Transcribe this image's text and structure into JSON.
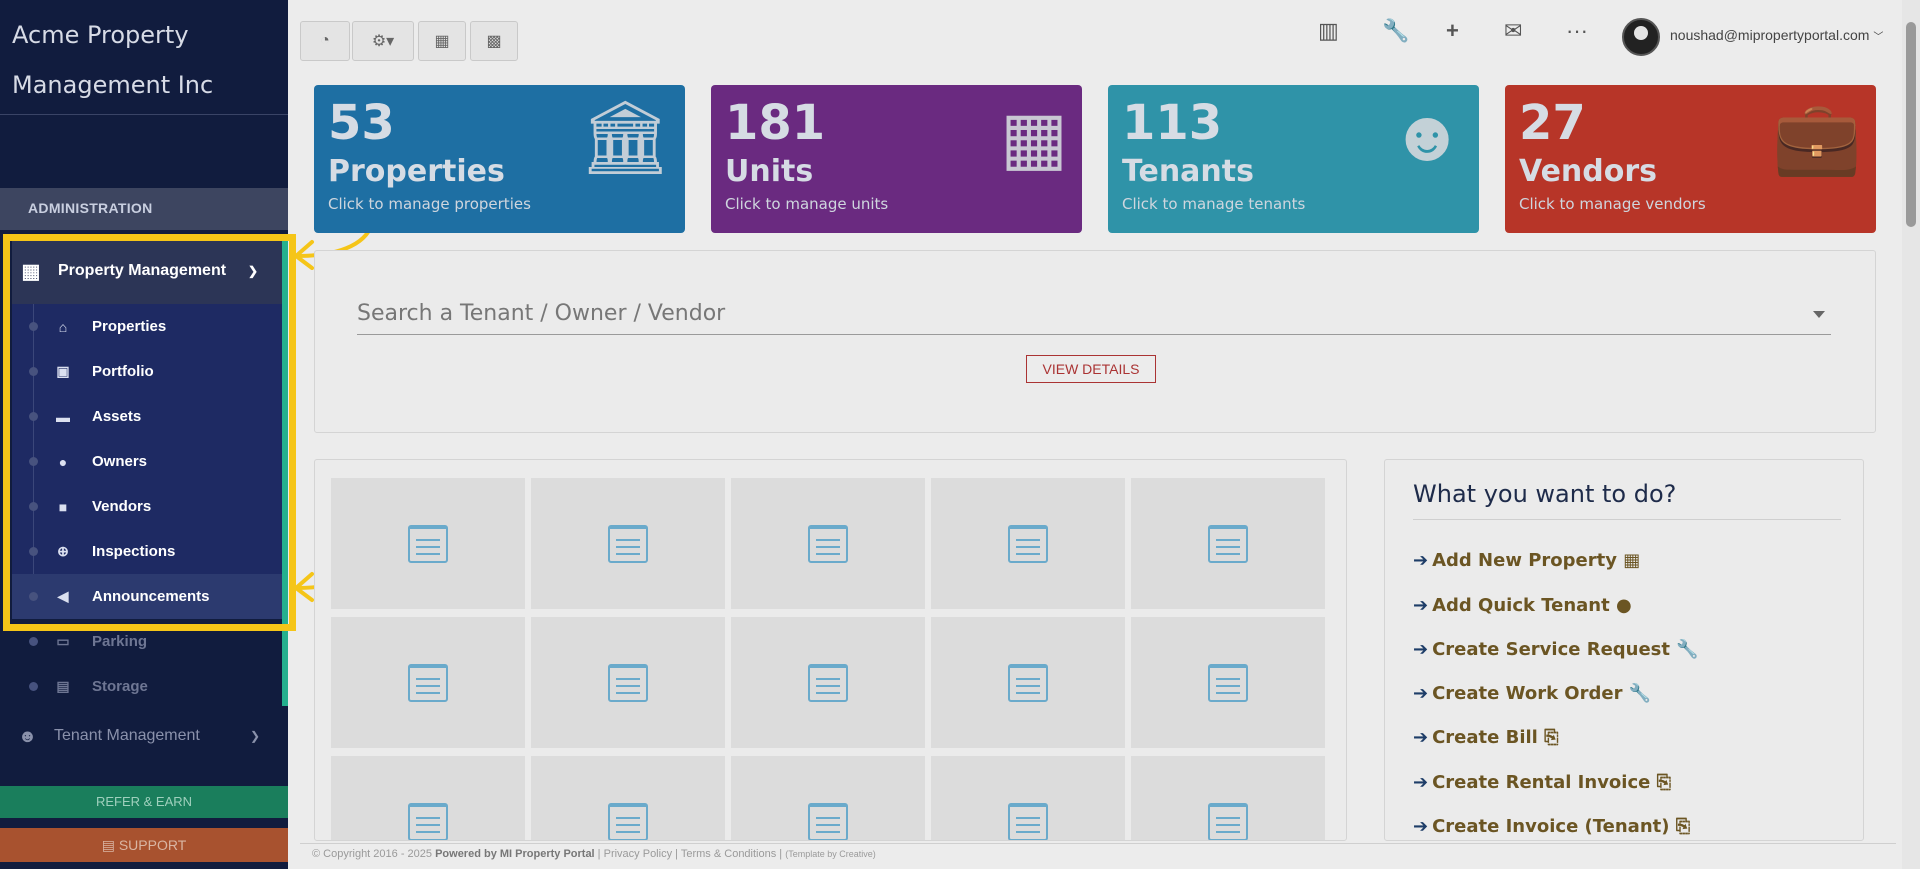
{
  "sidebar": {
    "brand": "Acme Property Management Inc",
    "section_header": "ADMINISTRATION",
    "property_management": {
      "label": "Property Management",
      "items": [
        {
          "label": "Properties",
          "icon": "home-icon"
        },
        {
          "label": "Portfolio",
          "icon": "portfolio-icon"
        },
        {
          "label": "Assets",
          "icon": "archive-icon"
        },
        {
          "label": "Owners",
          "icon": "user-icon"
        },
        {
          "label": "Vendors",
          "icon": "briefcase-icon"
        },
        {
          "label": "Inspections",
          "icon": "search-plus-icon"
        },
        {
          "label": "Announcements",
          "icon": "bullhorn-icon"
        },
        {
          "label": "Parking",
          "icon": "car-icon"
        },
        {
          "label": "Storage",
          "icon": "basket-icon"
        }
      ]
    },
    "tenant_management": "Tenant Management",
    "refer": "REFER & EARN",
    "support": "SUPPORT"
  },
  "topbar": {
    "user_email": "noushad@mipropertyportal.com"
  },
  "cards": [
    {
      "number": "53",
      "title": "Properties",
      "subtitle": "Click to manage properties",
      "color": "#1e6fa3",
      "icon": "bank-icon"
    },
    {
      "number": "181",
      "title": "Units",
      "subtitle": "Click to manage units",
      "color": "#6a2a80",
      "icon": "building-icon"
    },
    {
      "number": "113",
      "title": "Tenants",
      "subtitle": "Click to manage tenants",
      "color": "#2f93a8",
      "icon": "users-icon"
    },
    {
      "number": "27",
      "title": "Vendors",
      "subtitle": "Click to manage vendors",
      "color": "#b73528",
      "icon": "suitcase-icon"
    }
  ],
  "search": {
    "placeholder": "Search a Tenant / Owner / Vendor",
    "button": "VIEW DETAILS"
  },
  "quick_actions": {
    "title": "What you want to do?",
    "items": [
      "Add New Property",
      "Add Quick Tenant",
      "Create Service Request",
      "Create Work Order",
      "Create Bill",
      "Create Rental Invoice",
      "Create Invoice (Tenant)"
    ]
  },
  "footer": {
    "copyright": "© Copyright 2016 - 2025",
    "powered": "Powered by MI Property Portal",
    "privacy": "Privacy Policy",
    "terms": "Terms & Conditions",
    "template": "(Template by Creative)"
  },
  "colors": {
    "sidebar_bg": "#111c3e",
    "highlight": "#f5c518",
    "accent_green": "#25b08e"
  }
}
